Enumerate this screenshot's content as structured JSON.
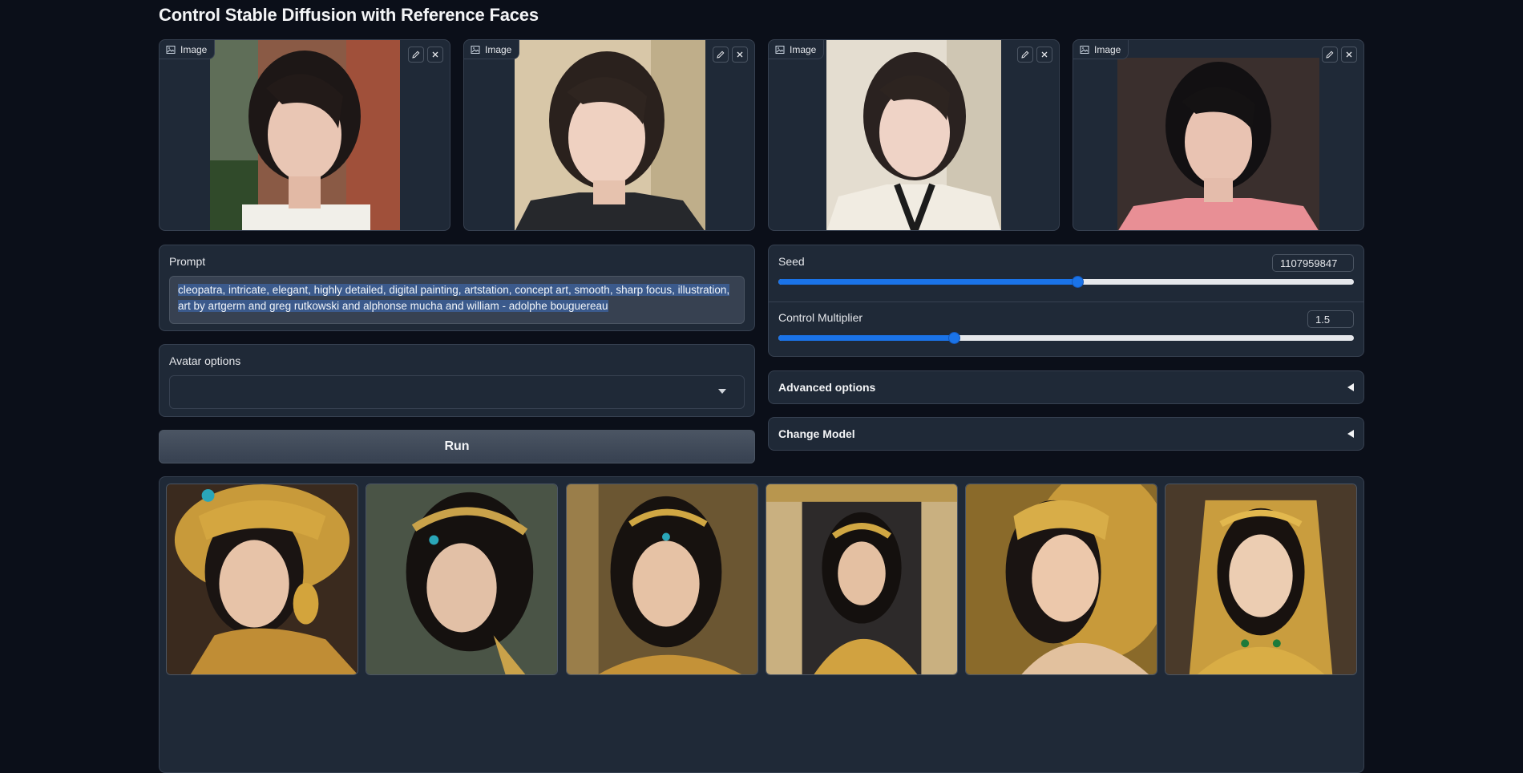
{
  "page": {
    "title": "Control Stable Diffusion with Reference Faces"
  },
  "reference_images": [
    {
      "label": "Image"
    },
    {
      "label": "Image"
    },
    {
      "label": "Image"
    },
    {
      "label": "Image"
    }
  ],
  "prompt": {
    "label": "Prompt",
    "value": "cleopatra, intricate, elegant, highly detailed, digital painting, artstation, concept art, smooth, sharp focus, illustration, art by artgerm and greg rutkowski and alphonse mucha and william - adolphe bouguereau"
  },
  "avatar_options": {
    "label": "Avatar options",
    "value": ""
  },
  "run_button": {
    "label": "Run"
  },
  "seed": {
    "label": "Seed",
    "value": "1107959847",
    "fraction": 0.52
  },
  "control_multiplier": {
    "label": "Control Multiplier",
    "value": "1.5",
    "fraction": 0.305
  },
  "advanced_options": {
    "label": "Advanced options"
  },
  "change_model": {
    "label": "Change Model"
  },
  "colors": {
    "background": "#0b0f19",
    "panel": "#1f2937",
    "border": "#374151",
    "accent": "#1a73e8",
    "selection": "#3b5a8c"
  },
  "gallery": {
    "count": 6
  }
}
